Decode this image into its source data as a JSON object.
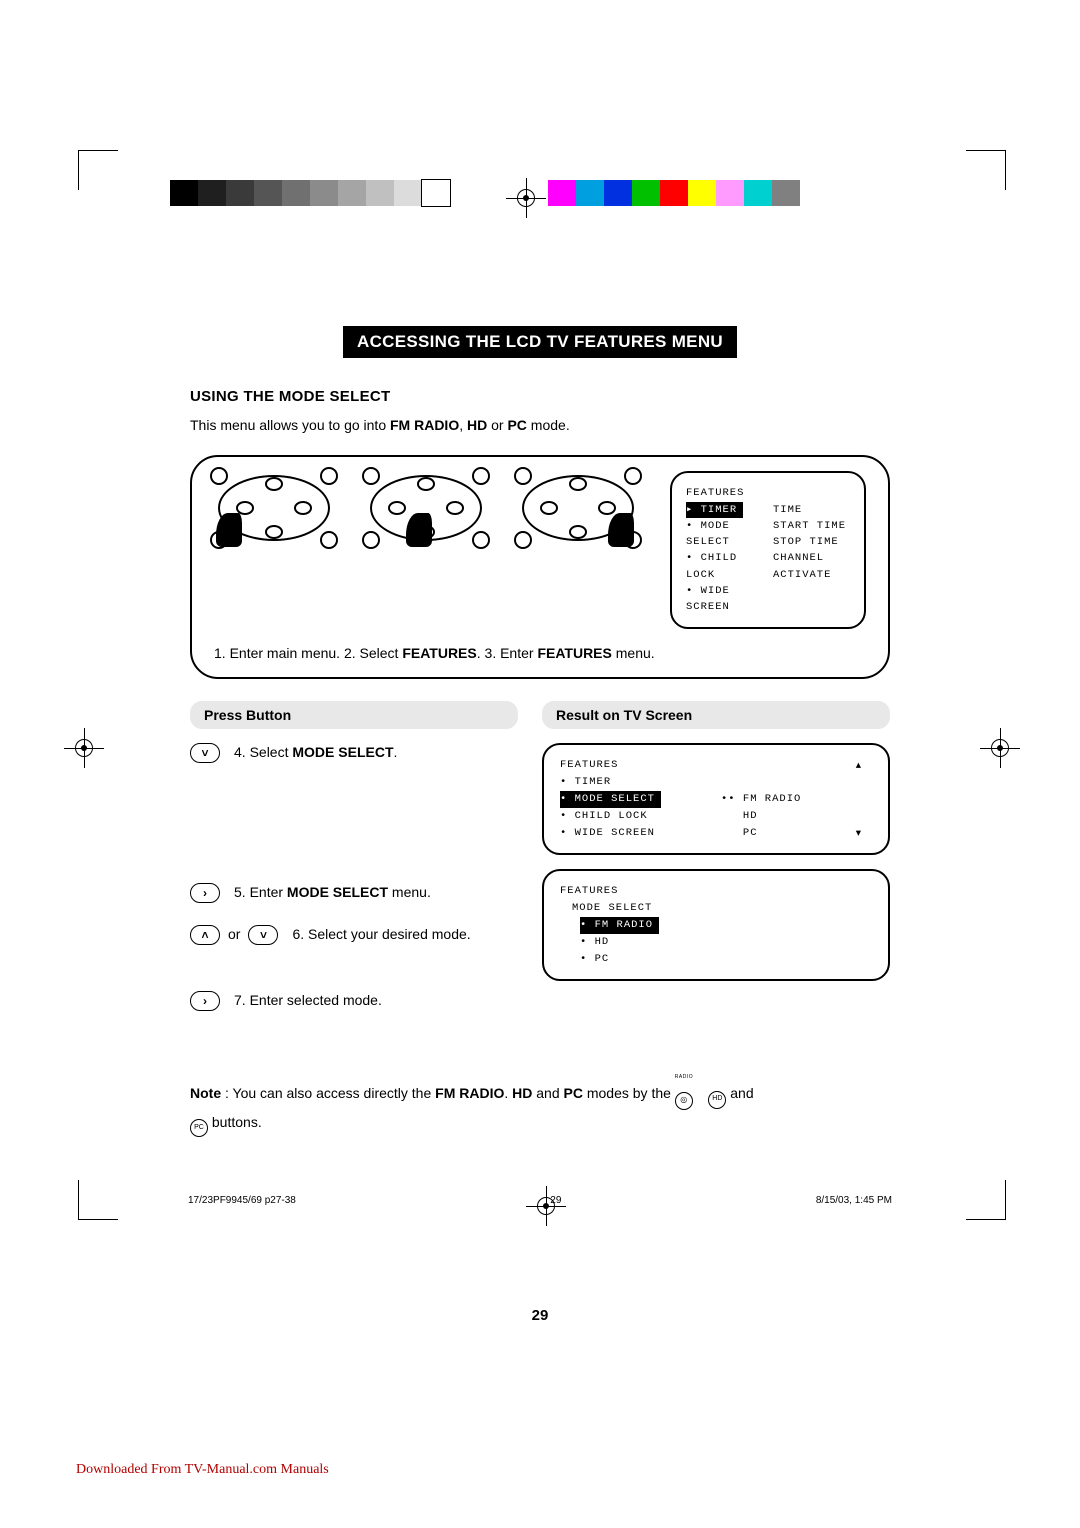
{
  "colors": {
    "gray_swatches": [
      "#000000",
      "#1f1f1f",
      "#3a3a3a",
      "#555555",
      "#707070",
      "#8b8b8b",
      "#a5a5a5",
      "#c0c0c0",
      "#dcdcdc",
      "#ffffff"
    ],
    "color_swatches": [
      "#ff00ff",
      "#00a0e0",
      "#0030e0",
      "#00c000",
      "#ff0000",
      "#ffff00",
      "#ff9aff",
      "#00d0d0",
      "#808080"
    ]
  },
  "banner": "ACCESSING THE LCD TV FEATURES MENU",
  "subhead": "USING THE MODE SELECT",
  "intro_a": "This menu allows you to go into ",
  "intro_b": "FM RADIO",
  "intro_c": ", ",
  "intro_d": "HD",
  "intro_e": " or ",
  "intro_f": "PC",
  "intro_g": " mode.",
  "menu_features_title": "FEATURES",
  "menu_left_items": [
    "TIMER",
    "MODE SELECT",
    "CHILD LOCK",
    "WIDE SCREEN"
  ],
  "menu_right_items": [
    "TIME",
    "START TIME",
    "STOP TIME",
    "CHANNEL",
    "ACTIVATE"
  ],
  "steps_under_a": "1.  Enter main menu.   2.  Select ",
  "steps_under_b": "FEATURES",
  "steps_under_c": ".   3.  Enter ",
  "steps_under_d": "FEATURES",
  "steps_under_e": " menu.",
  "col_header_left": "Press Button",
  "col_header_right": "Result on TV Screen",
  "step4_a": "4.  Select ",
  "step4_b": "MODE SELECT",
  "step4_c": ".",
  "step5_a": "5. Enter ",
  "step5_b": "MODE SELECT",
  "step5_c": " menu.",
  "step6": "6.  Select your desired mode.",
  "step6_or": "or",
  "step7": "7.  Enter selected mode.",
  "result1_title": "FEATURES",
  "result1_left": [
    "TIMER",
    "MODE SELECT",
    "CHILD LOCK",
    "WIDE SCREEN"
  ],
  "result1_right": [
    "FM RADIO",
    "HD",
    "PC"
  ],
  "result2_title": "FEATURES",
  "result2_sub": "MODE SELECT",
  "result2_items": [
    "FM RADIO",
    "HD",
    "PC"
  ],
  "note_a": "Note",
  "note_b": " :  You can also access directly the ",
  "note_c": "FM RADIO",
  "note_d": ". ",
  "note_e": "HD",
  "note_f": " and ",
  "note_g": "PC",
  "note_h": " modes by the ",
  "note_icon1": "RADIO",
  "note_icon2": "HD",
  "note_icon3": "PC",
  "note_and": " and",
  "note_tail": " buttons.",
  "page_number": "29",
  "impo_left": "17/23PF9945/69 p27-38",
  "impo_mid": "29",
  "impo_right": "8/15/03, 1:45 PM",
  "download_link": "Downloaded From TV-Manual.com Manuals"
}
